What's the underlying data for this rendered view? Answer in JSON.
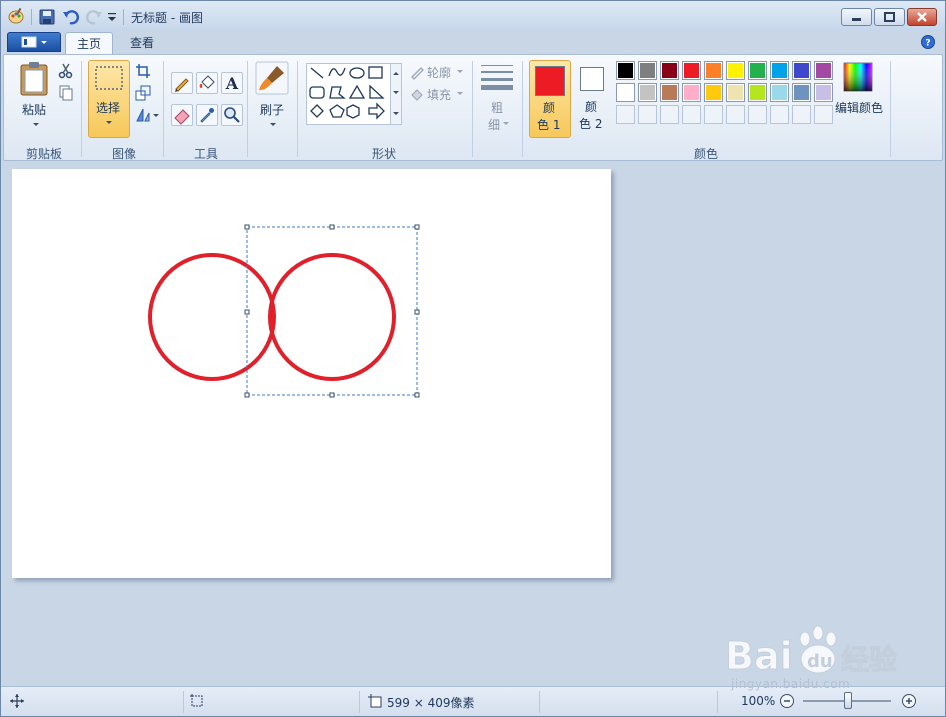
{
  "window": {
    "title": "无标题 - 画图"
  },
  "tabs": {
    "home": "主页",
    "view": "查看"
  },
  "ribbon": {
    "clipboard": {
      "paste_label": "粘贴",
      "group_label": "剪贴板"
    },
    "image": {
      "select_label": "选择",
      "group_label": "图像"
    },
    "tools": {
      "group_label": "工具"
    },
    "brushes": {
      "label": "刷子"
    },
    "shapes": {
      "outline_label": "轮廓",
      "fill_label": "填充",
      "group_label": "形状"
    },
    "size": {
      "label_1": "粗",
      "label_2": "细"
    },
    "colors": {
      "color1_label_1": "颜",
      "color1_label_2": "色 1",
      "color2_label_1": "颜",
      "color2_label_2": "色 2",
      "edit_colors_label": "编辑颜色",
      "group_label": "颜色",
      "color1_value": "#ed1c24",
      "color2_value": "#ffffff",
      "palette_row1": [
        "#000000",
        "#7f7f7f",
        "#880015",
        "#ed1c24",
        "#ff7f27",
        "#fff200",
        "#22b14c",
        "#00a2e8",
        "#3f48cc",
        "#a349a4"
      ],
      "palette_row2": [
        "#ffffff",
        "#c3c3c3",
        "#b97a57",
        "#ffaec9",
        "#ffc90e",
        "#efe4b0",
        "#b5e61d",
        "#99d9ea",
        "#7092be",
        "#c8bfe7"
      ]
    }
  },
  "canvas": {
    "stroke_color": "#e0202a"
  },
  "statusbar": {
    "canvas_size": "599 × 409像素",
    "zoom": "100%"
  },
  "watermark": {
    "brand": "Bai",
    "brand2": "du",
    "brand_cn": "经验",
    "url": "jingyan.baidu.com"
  }
}
